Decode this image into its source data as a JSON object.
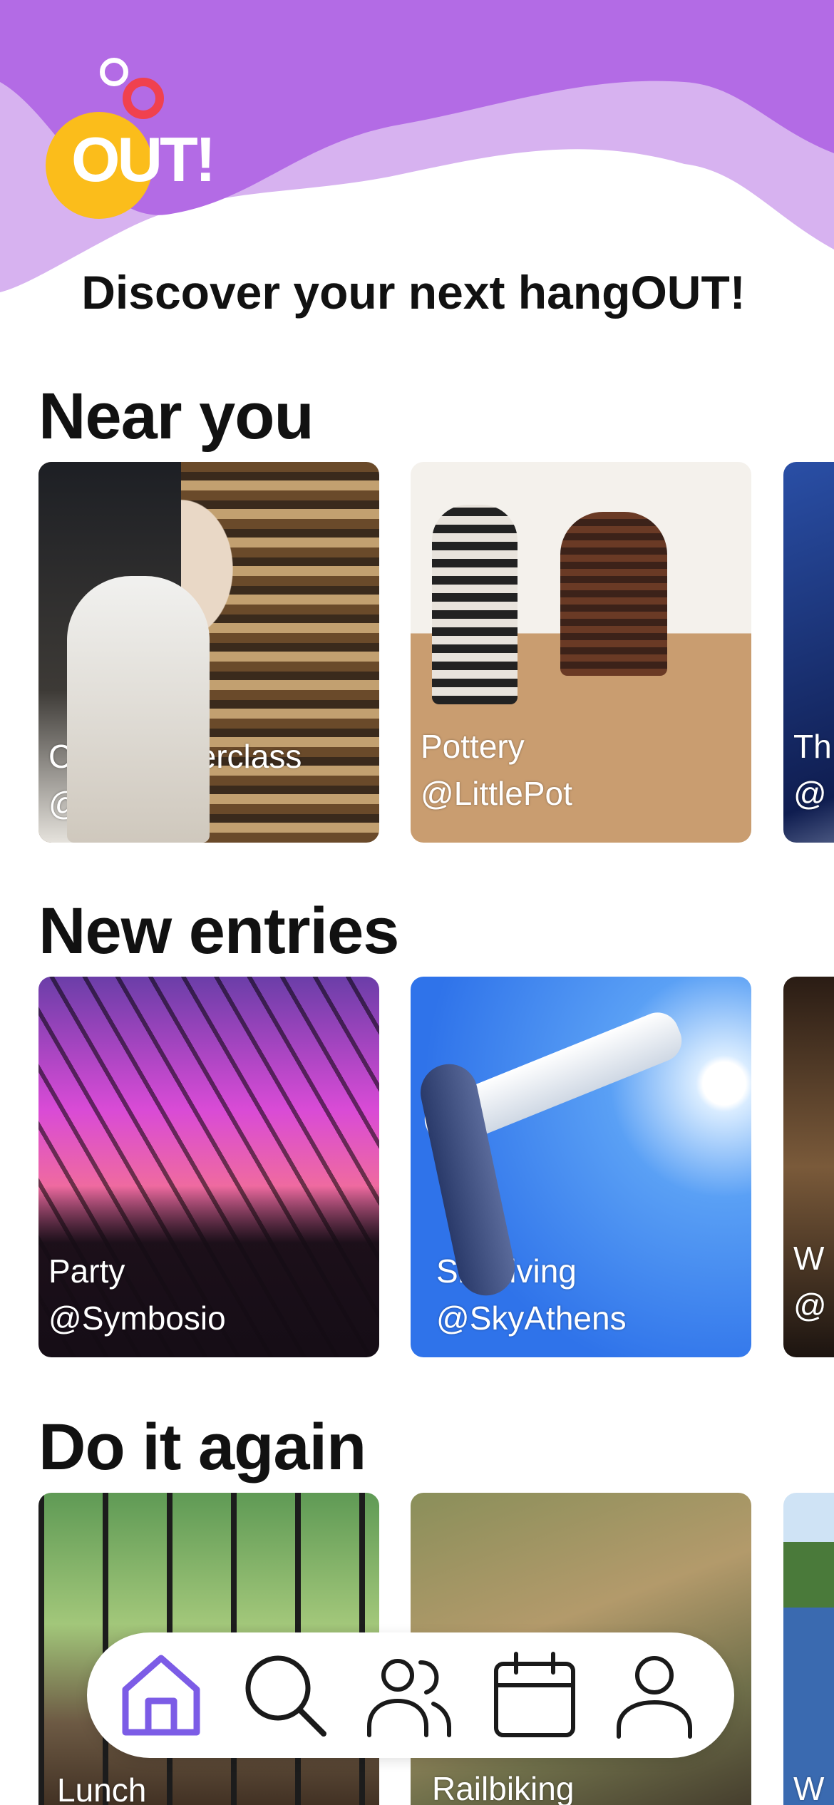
{
  "colors": {
    "header_purple": "#b36be5",
    "header_lilac": "#d7b2f0",
    "logo_yellow": "#fbbd1b",
    "logo_red": "#f0414f",
    "nav_active": "#7c5ce6",
    "nav_inactive": "#1a1a1a"
  },
  "logo": {
    "text": "OUT!"
  },
  "tagline": "Discover your next hangOUT!",
  "sections": [
    {
      "title": "Near you",
      "cards": [
        {
          "title": "Chef masterclass",
          "host": "@oz37"
        },
        {
          "title": "Pottery",
          "host": "@LittlePot"
        },
        {
          "title": "Th",
          "host": "@"
        }
      ]
    },
    {
      "title": "New entries",
      "cards": [
        {
          "title": "Party",
          "host": "@Symbosio"
        },
        {
          "title": "Skydiving",
          "host": "@SkyAthens"
        },
        {
          "title": "W",
          "host": "@"
        }
      ]
    },
    {
      "title": "Do it again",
      "cards": [
        {
          "title": "Lunch",
          "host": ""
        },
        {
          "title": "Railbiking",
          "host": ""
        },
        {
          "title": "W",
          "host": ""
        }
      ]
    }
  ],
  "nav": [
    {
      "icon": "home-icon",
      "active": true
    },
    {
      "icon": "search-icon",
      "active": false
    },
    {
      "icon": "friends-icon",
      "active": false
    },
    {
      "icon": "calendar-icon",
      "active": false
    },
    {
      "icon": "profile-icon",
      "active": false
    }
  ]
}
